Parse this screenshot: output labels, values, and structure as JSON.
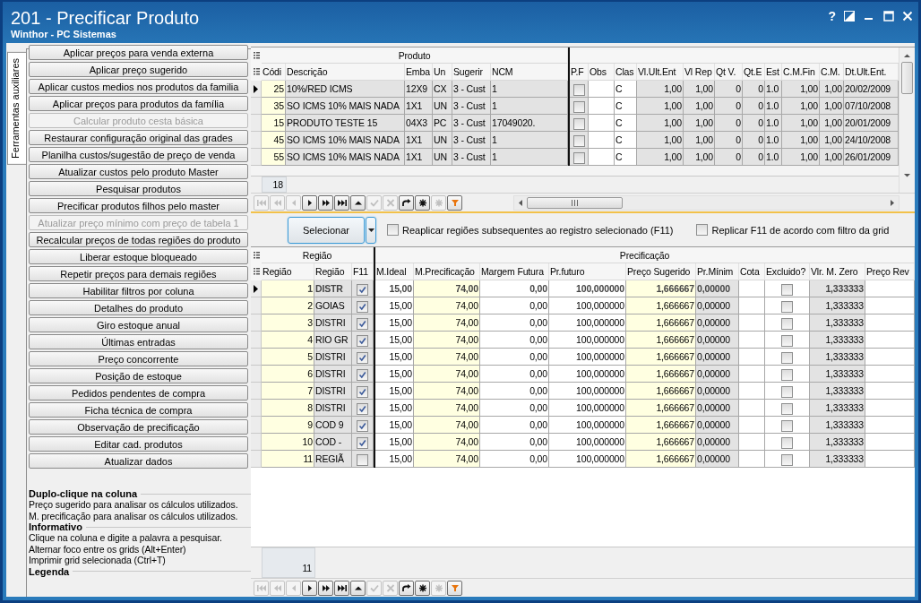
{
  "window": {
    "title": "201 - Precificar Produto",
    "subtitle": "Winthor - PC Sistemas",
    "help": "?"
  },
  "side_tab": {
    "label": "Ferramentas auxiliares",
    "selected": true
  },
  "tool_buttons": [
    {
      "label": "Aplicar preços para venda externa",
      "disabled": false
    },
    {
      "label": "Aplicar preço sugerido",
      "disabled": false
    },
    {
      "label": "Aplicar custos medios nos produtos da familia",
      "disabled": false
    },
    {
      "label": "Aplicar preços para produtos da família",
      "disabled": false
    },
    {
      "label": "Calcular produto cesta básica",
      "disabled": true
    },
    {
      "label": "Restaurar configuração original das grades",
      "disabled": false
    },
    {
      "label": "Planilha custos/sugestão de preço de venda",
      "disabled": false
    },
    {
      "label": "Atualizar custos pelo produto Master",
      "disabled": false
    },
    {
      "label": "Pesquisar produtos",
      "disabled": false
    },
    {
      "label": "Precificar produtos filhos pelo master",
      "disabled": false
    },
    {
      "label": "Atualizar preço mínimo com preço de tabela 1",
      "disabled": true
    },
    {
      "label": "Recalcular preços de todas regiões do produto",
      "disabled": false
    },
    {
      "label": "Liberar estoque bloqueado",
      "disabled": false
    },
    {
      "label": "Repetir preços para demais regiões",
      "disabled": false
    },
    {
      "label": "Habilitar filtros por coluna",
      "disabled": false
    },
    {
      "label": "Detalhes do produto",
      "disabled": false
    },
    {
      "label": "Giro estoque anual",
      "disabled": false
    },
    {
      "label": "Últimas entradas",
      "disabled": false
    },
    {
      "label": "Preço concorrente",
      "disabled": false
    },
    {
      "label": "Posição de estoque",
      "disabled": false
    },
    {
      "label": "Pedidos pendentes de compra",
      "disabled": false
    },
    {
      "label": "Ficha técnica de compra",
      "disabled": false
    },
    {
      "label": "Observação de precificação",
      "disabled": false
    },
    {
      "label": "Editar cad. produtos",
      "disabled": false
    },
    {
      "label": "Atualizar dados",
      "disabled": false
    }
  ],
  "info_sections": [
    {
      "heading": "Duplo-clique na coluna",
      "lines": [
        "Preço sugerido para analisar os cálculos utilizados.",
        "M. precificação para analisar os cálculos utilizados."
      ]
    },
    {
      "heading": "Informativo",
      "lines": [
        "Clique na coluna e digite a palavra a pesquisar.",
        "Alternar foco entre os grids (Alt+Enter)",
        "Imprimir grid selecionada (Ctrl+T)"
      ]
    },
    {
      "heading": "Legenda"
    }
  ],
  "product_grid": {
    "groups": [
      "Produto"
    ],
    "columns": [
      {
        "label": "Códi",
        "kind": "key"
      },
      {
        "label": "Descrição",
        "kind": "text"
      },
      {
        "label": "Emba",
        "kind": "text"
      },
      {
        "label": "Un",
        "kind": "text"
      },
      {
        "label": "Sugerir",
        "kind": "text"
      },
      {
        "label": "NCM",
        "kind": "text"
      },
      {
        "label": "P.F",
        "kind": "check"
      },
      {
        "label": "Obs",
        "kind": "entry-text"
      },
      {
        "label": "Clas",
        "kind": "entry-text"
      },
      {
        "label": "Vl.Ult.Ent",
        "kind": "num"
      },
      {
        "label": "Vl Rep",
        "kind": "num"
      },
      {
        "label": "Qt V.",
        "kind": "num"
      },
      {
        "label": "Qt.E",
        "kind": "num"
      },
      {
        "label": "Est",
        "kind": "text"
      },
      {
        "label": "C.M.Fin",
        "kind": "num"
      },
      {
        "label": "C.M.",
        "kind": "num"
      },
      {
        "label": "Dt.Ult.Ent.",
        "kind": "text"
      }
    ],
    "rows": [
      {
        "selected": true,
        "cells": [
          "25",
          "10%/RED ICMS",
          "12X9",
          "CX",
          "3 - Cust",
          "1",
          {
            "checked": false
          },
          null,
          "C",
          "1,00",
          "1,00",
          "0",
          "0",
          "1.0",
          "1,00",
          "1,00",
          "20/02/2009"
        ]
      },
      {
        "selected": false,
        "cells": [
          "35",
          "SO ICMS 10% MAIS NADA",
          "1X1",
          "UN",
          "3 - Cust",
          "1",
          {
            "checked": false
          },
          null,
          "C",
          "1,00",
          "1,00",
          "0",
          "0",
          "1.0",
          "1,00",
          "1,00",
          "07/10/2008"
        ]
      },
      {
        "selected": false,
        "cells": [
          "15",
          "PRODUTO TESTE 15",
          "04X3",
          "PC",
          "3 - Cust",
          "17049020.",
          {
            "checked": false
          },
          null,
          "C",
          "1,00",
          "1,00",
          "0",
          "0",
          "1.0",
          "1,00",
          "1,00",
          "20/01/2009"
        ]
      },
      {
        "selected": false,
        "cells": [
          "45",
          "SO ICMS 10% MAIS NADA",
          "1X1",
          "UN",
          "3 - Cust",
          "1",
          {
            "checked": false
          },
          null,
          "C",
          "1,00",
          "1,00",
          "0",
          "0",
          "1.0",
          "1,00",
          "1,00",
          "24/10/2008"
        ]
      },
      {
        "selected": false,
        "cells": [
          "55",
          "SO ICMS 10% MAIS NADA",
          "1X1",
          "UN",
          "3 - Cust",
          "1",
          {
            "checked": false
          },
          null,
          "C",
          "1,00",
          "1,00",
          "0",
          "0",
          "1.0",
          "1,00",
          "1,00",
          "26/01/2009"
        ]
      }
    ],
    "count": "18"
  },
  "product_nav": [
    {
      "kind": "first",
      "disabled": true
    },
    {
      "kind": "prior-page",
      "disabled": true
    },
    {
      "kind": "prior",
      "disabled": true
    },
    {
      "kind": "next",
      "disabled": false
    },
    {
      "kind": "next-page",
      "disabled": false
    },
    {
      "kind": "last",
      "disabled": false
    },
    {
      "kind": "insert",
      "disabled": false
    },
    {
      "kind": "post",
      "disabled": true
    },
    {
      "kind": "cancel",
      "disabled": true
    },
    {
      "kind": "refresh",
      "disabled": false
    },
    {
      "kind": "asterisk",
      "disabled": false
    },
    {
      "kind": "asterisk",
      "disabled": true
    },
    {
      "kind": "filter",
      "disabled": false
    }
  ],
  "action_bar": {
    "button": "Selecionar",
    "options": [
      {
        "label": "Reaplicar regiões subsequentes ao registro selecionado (F11)",
        "checked": false
      },
      {
        "label": "Replicar F11 de acordo com filtro da grid",
        "checked": false
      }
    ]
  },
  "region_grid": {
    "groups": [
      "Região",
      "Precificação"
    ],
    "columns": [
      {
        "label": "Região",
        "kind": "key"
      },
      {
        "label": "Região",
        "kind": "text"
      },
      {
        "label": "F11",
        "kind": "check"
      },
      {
        "label": "M.Ideal",
        "kind": "entry"
      },
      {
        "label": "M.Precificação",
        "kind": "key"
      },
      {
        "label": "Margem Futura",
        "kind": "entry"
      },
      {
        "label": "Pr.futuro",
        "kind": "entry"
      },
      {
        "label": "Preço Sugerido",
        "kind": "key"
      },
      {
        "label": "Pr.Mínim",
        "kind": "text"
      },
      {
        "label": "Cota",
        "kind": "entry"
      },
      {
        "label": "Excluido?",
        "kind": "check-entry"
      },
      {
        "label": "Vlr. M. Zero",
        "kind": "num"
      },
      {
        "label": "Preço Rev",
        "kind": "entry"
      }
    ],
    "rows": [
      {
        "selected": true,
        "cells": [
          "1",
          "DISTR",
          {
            "checked": true
          },
          "15,00",
          "74,00",
          "0,00",
          "100,000000",
          "1,666667",
          "0,00000",
          null,
          {
            "checked": false
          },
          "1,333333",
          null
        ]
      },
      {
        "selected": false,
        "cells": [
          "2",
          "GOIAS",
          {
            "checked": true
          },
          "15,00",
          "74,00",
          "0,00",
          "100,000000",
          "1,666667",
          "0,00000",
          null,
          {
            "checked": false
          },
          "1,333333",
          null
        ]
      },
      {
        "selected": false,
        "cells": [
          "3",
          "DISTRI",
          {
            "checked": true
          },
          "15,00",
          "74,00",
          "0,00",
          "100,000000",
          "1,666667",
          "0,00000",
          null,
          {
            "checked": false
          },
          "1,333333",
          null
        ]
      },
      {
        "selected": false,
        "cells": [
          "4",
          "RIO GR",
          {
            "checked": true
          },
          "15,00",
          "74,00",
          "0,00",
          "100,000000",
          "1,666667",
          "0,00000",
          null,
          {
            "checked": false
          },
          "1,333333",
          null
        ]
      },
      {
        "selected": false,
        "cells": [
          "5",
          "DISTRI",
          {
            "checked": true
          },
          "15,00",
          "74,00",
          "0,00",
          "100,000000",
          "1,666667",
          "0,00000",
          null,
          {
            "checked": false
          },
          "1,333333",
          null
        ]
      },
      {
        "selected": false,
        "cells": [
          "6",
          "DISTRI",
          {
            "checked": true
          },
          "15,00",
          "74,00",
          "0,00",
          "100,000000",
          "1,666667",
          "0,00000",
          null,
          {
            "checked": false
          },
          "1,333333",
          null
        ]
      },
      {
        "selected": false,
        "cells": [
          "7",
          "DISTRI",
          {
            "checked": true
          },
          "15,00",
          "74,00",
          "0,00",
          "100,000000",
          "1,666667",
          "0,00000",
          null,
          {
            "checked": false
          },
          "1,333333",
          null
        ]
      },
      {
        "selected": false,
        "cells": [
          "8",
          "DISTRI",
          {
            "checked": true
          },
          "15,00",
          "74,00",
          "0,00",
          "100,000000",
          "1,666667",
          "0,00000",
          null,
          {
            "checked": false
          },
          "1,333333",
          null
        ]
      },
      {
        "selected": false,
        "cells": [
          "9",
          "COD 9",
          {
            "checked": true
          },
          "15,00",
          "74,00",
          "0,00",
          "100,000000",
          "1,666667",
          "0,00000",
          null,
          {
            "checked": false
          },
          "1,333333",
          null
        ]
      },
      {
        "selected": false,
        "cells": [
          "10",
          "COD -",
          {
            "checked": true
          },
          "15,00",
          "74,00",
          "0,00",
          "100,000000",
          "1,666667",
          "0,00000",
          null,
          {
            "checked": false
          },
          "1,333333",
          null
        ]
      },
      {
        "selected": false,
        "cells": [
          "11",
          "REGIÃ",
          {
            "checked": false
          },
          "15,00",
          "74,00",
          "0,00",
          "100,000000",
          "1,666667",
          "0,00000",
          null,
          {
            "checked": false
          },
          "1,333333",
          null
        ]
      }
    ],
    "count": "11"
  },
  "region_nav": [
    {
      "kind": "first",
      "disabled": true
    },
    {
      "kind": "prior-page",
      "disabled": true
    },
    {
      "kind": "prior",
      "disabled": true
    },
    {
      "kind": "next",
      "disabled": false
    },
    {
      "kind": "next-page",
      "disabled": false
    },
    {
      "kind": "last",
      "disabled": false
    },
    {
      "kind": "insert",
      "disabled": false
    },
    {
      "kind": "post",
      "disabled": true
    },
    {
      "kind": "cancel",
      "disabled": true
    },
    {
      "kind": "refresh",
      "disabled": false
    },
    {
      "kind": "asterisk",
      "disabled": false
    },
    {
      "kind": "asterisk",
      "disabled": true
    },
    {
      "kind": "filter",
      "disabled": false
    }
  ]
}
